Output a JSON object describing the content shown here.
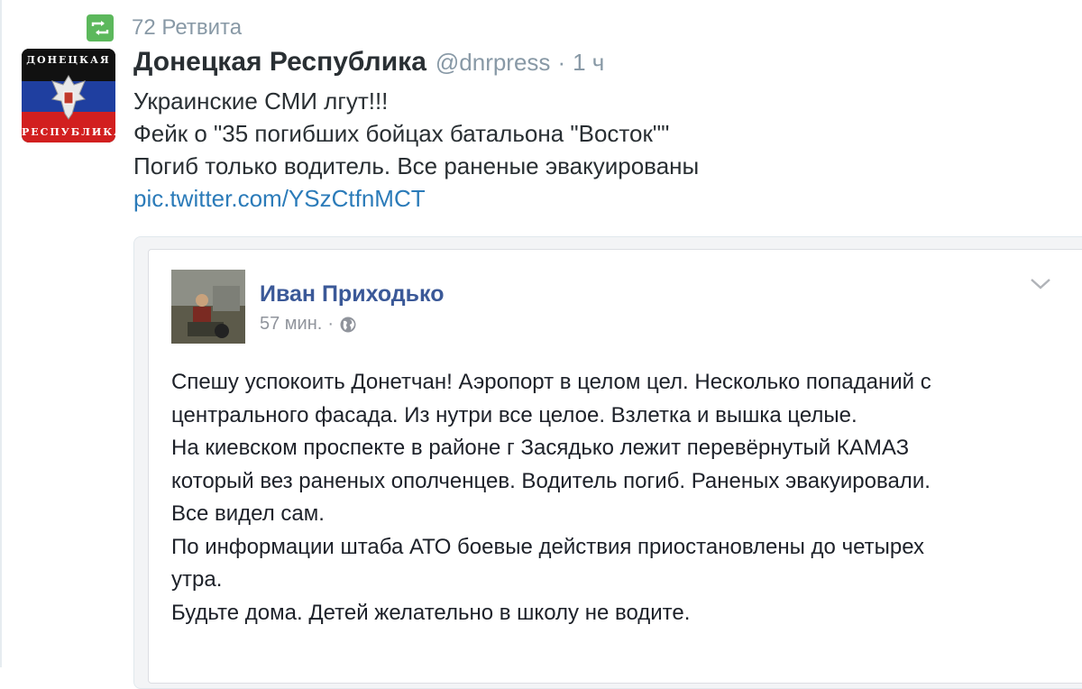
{
  "retweet": {
    "icon": "retweet-icon",
    "icon_color": "#5cb85c",
    "count_text": "72 Ретвита"
  },
  "tweet": {
    "avatar": {
      "icon": "dnr-flag-emblem",
      "text_top": "ДОНЕЦКАЯ",
      "text_bottom": "РЕСПУБЛИКА"
    },
    "display_name": "Донецкая Республика",
    "handle": "@dnrpress",
    "separator": "·",
    "time": "1 ч",
    "lines": [
      "Украинские СМИ лгут!!!",
      "Фейк о \"35 погибших бойцах батальона \"Восток\"\"",
      "Погиб только водитель. Все раненые эвакуированы"
    ],
    "link": "pic.twitter.com/YSzCtfnMCT",
    "link_color": "#2b7bb9"
  },
  "fb_post": {
    "author": "Иван Приходько",
    "author_color": "#3b5998",
    "time": "57 мин.",
    "separator": "·",
    "privacy_icon": "globe-icon",
    "menu_icon": "chevron-down-icon",
    "body_lines": [
      "Спешу успокоить Донетчан! Аэропорт в целом цел. Несколько попаданий с",
      "центрального фасада. Из нутри все целое. Взлетка и вышка целые.",
      "На киевском проспекте в районе г Засядько лежит перевёрнутый КАМАЗ",
      "который вез раненых ополченцев. Водитель погиб. Раненых эвакуировали.",
      "Все видел сам.",
      "По информации штаба АТО боевые действия приостановлены до четырех",
      "утра.",
      "Будьте дома. Детей желательно в школу не водите."
    ]
  }
}
